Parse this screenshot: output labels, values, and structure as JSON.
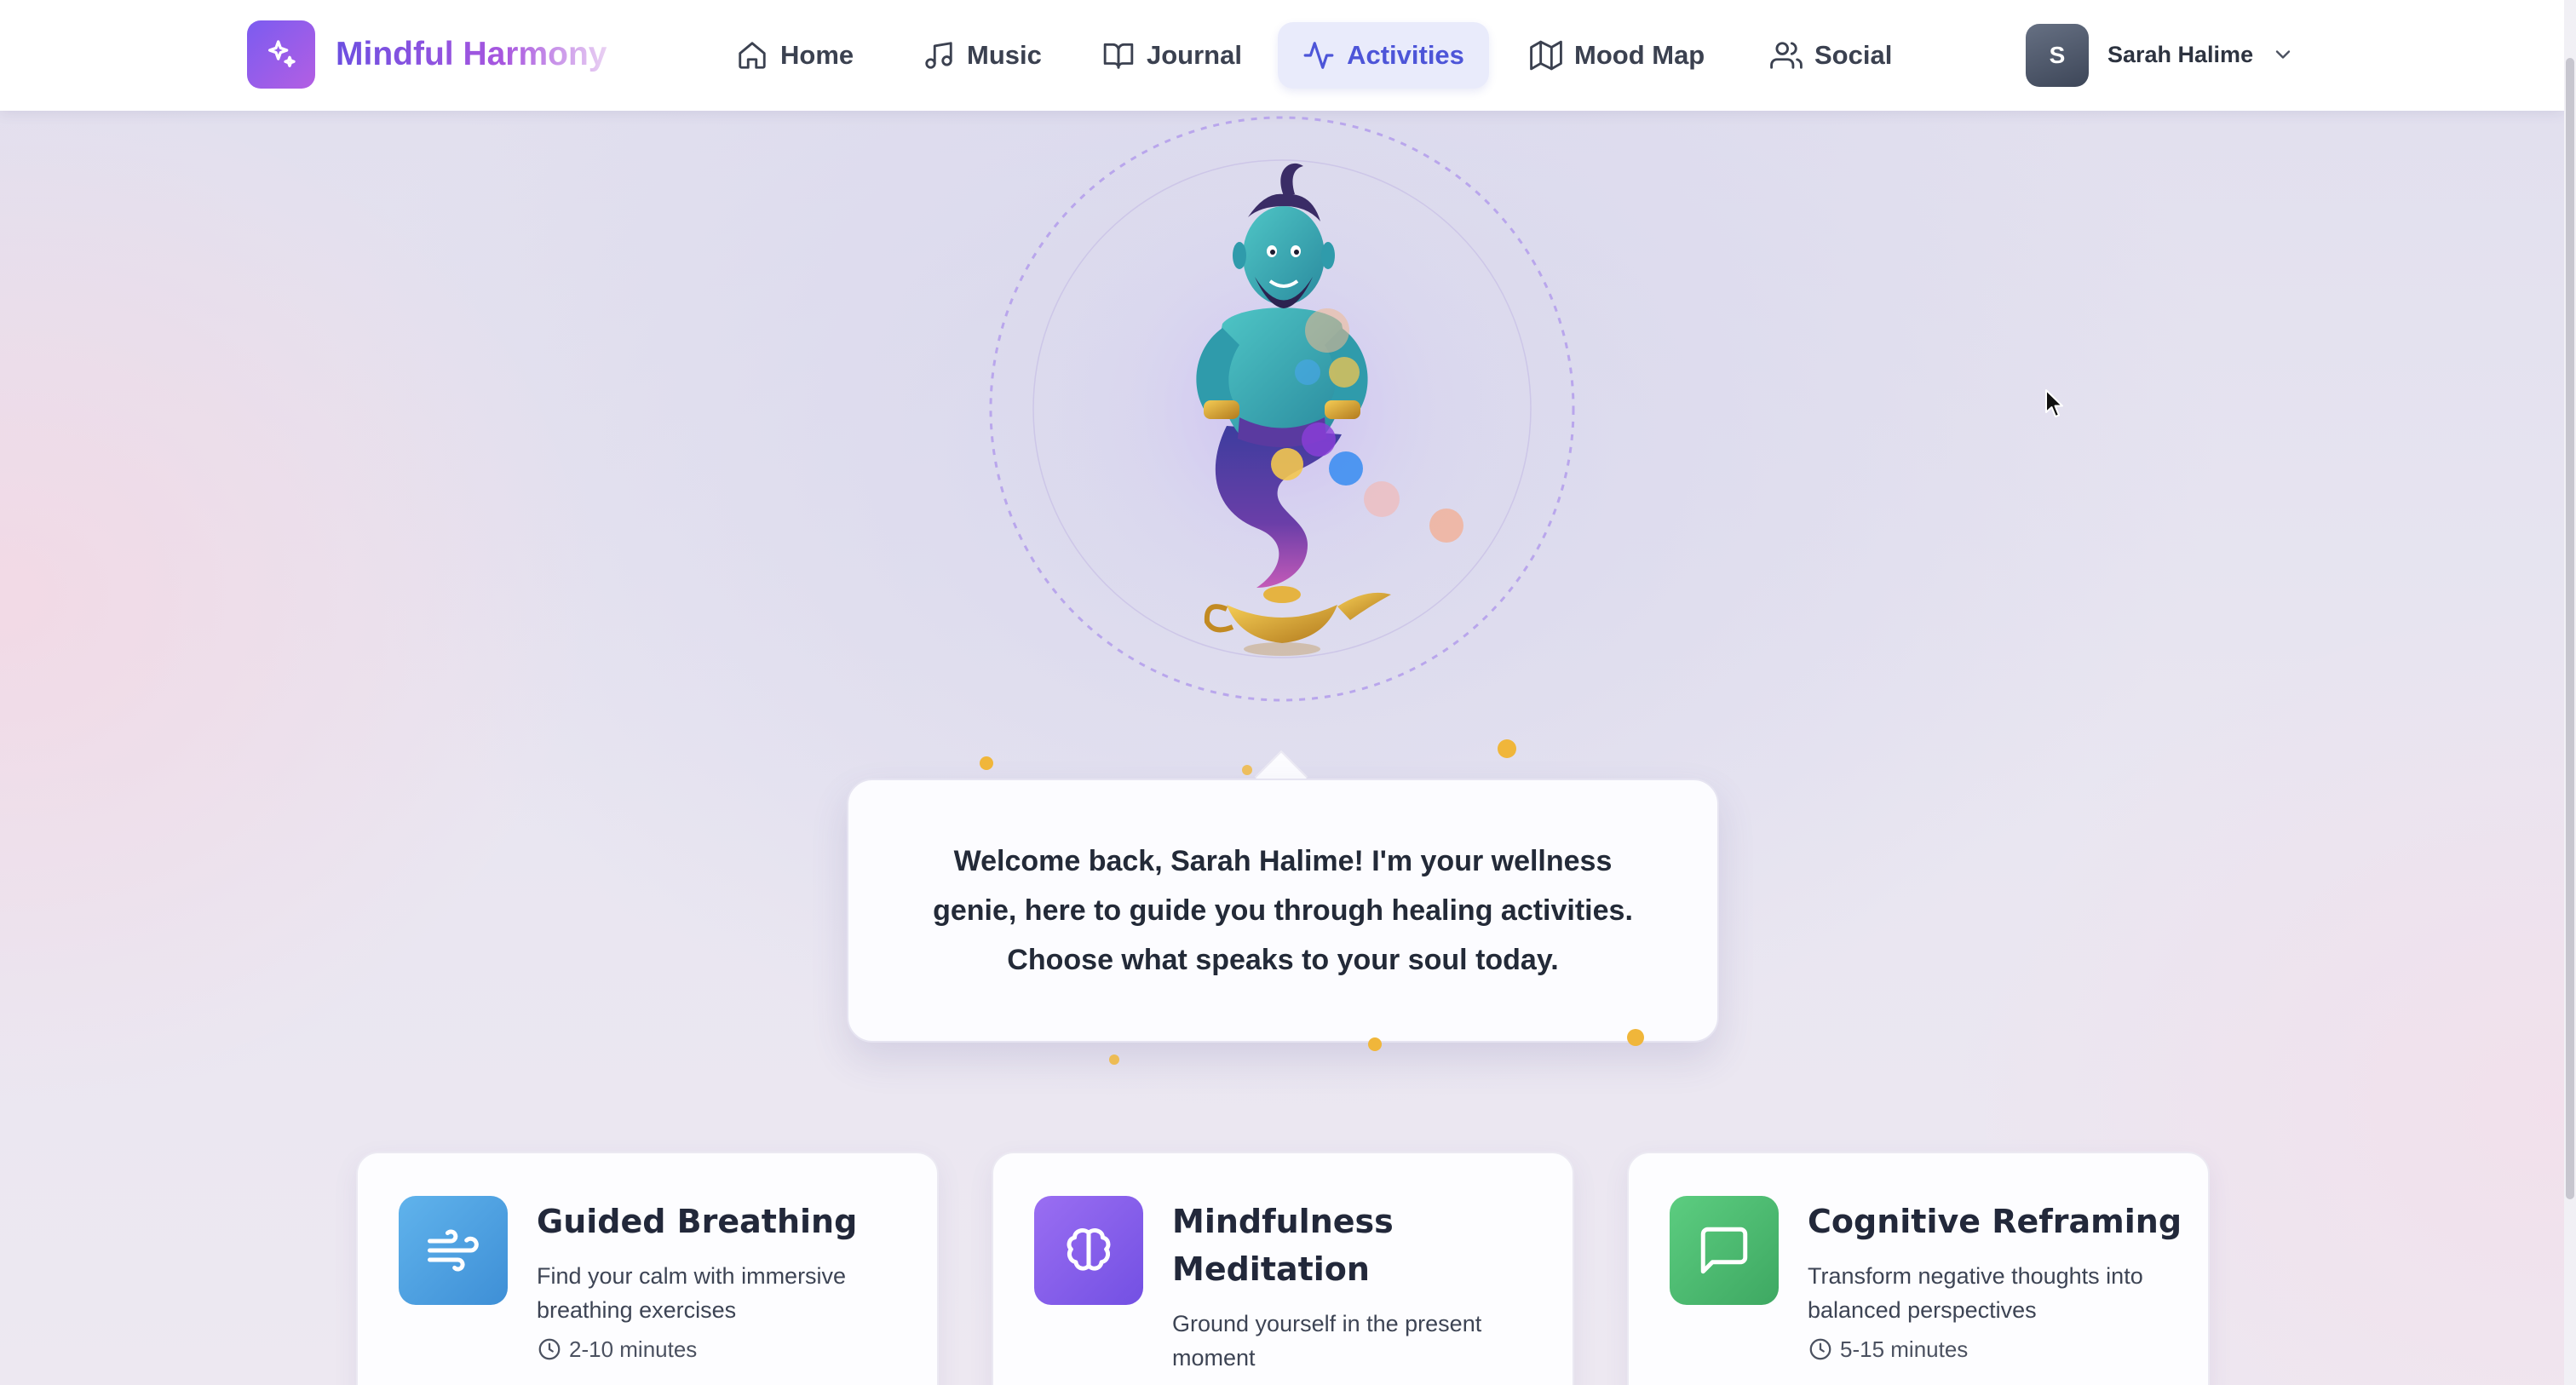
{
  "app": {
    "name": "Mindful Harmony",
    "logo_icon": "sparkles-icon",
    "accent": "#5b5fdb",
    "brand_gradient": [
      "#7b5cf0",
      "#b35ee3"
    ]
  },
  "nav": {
    "items": [
      {
        "label": "Home",
        "icon": "home-icon"
      },
      {
        "label": "Music",
        "icon": "music-note-icon"
      },
      {
        "label": "Journal",
        "icon": "book-icon"
      },
      {
        "label": "Activities",
        "icon": "activity-pulse-icon",
        "active": true
      },
      {
        "label": "Mood Map",
        "icon": "map-icon"
      },
      {
        "label": "Social",
        "icon": "users-icon"
      }
    ]
  },
  "user": {
    "initial": "S",
    "name": "Sarah Halime",
    "menu_icon": "chevron-down-icon"
  },
  "genie": {
    "message": "Welcome back, Sarah Halime! I'm your wellness genie, here to guide you through healing activities. Choose what speaks to your soul today."
  },
  "activities": [
    {
      "title": "Guided Breathing",
      "description": "Find your calm with immersive breathing exercises",
      "duration": "2-10 minutes",
      "icon": "wind-icon",
      "color": "#4fa3e4"
    },
    {
      "title": "Mindfulness Meditation",
      "description": "Ground yourself in the present moment",
      "icon": "brain-icon",
      "color": "#8a62ee"
    },
    {
      "title": "Cognitive Reframing",
      "description": "Transform negative thoughts into balanced perspectives",
      "duration": "5-15 minutes",
      "icon": "message-square-icon",
      "color": "#4cb96f"
    }
  ]
}
